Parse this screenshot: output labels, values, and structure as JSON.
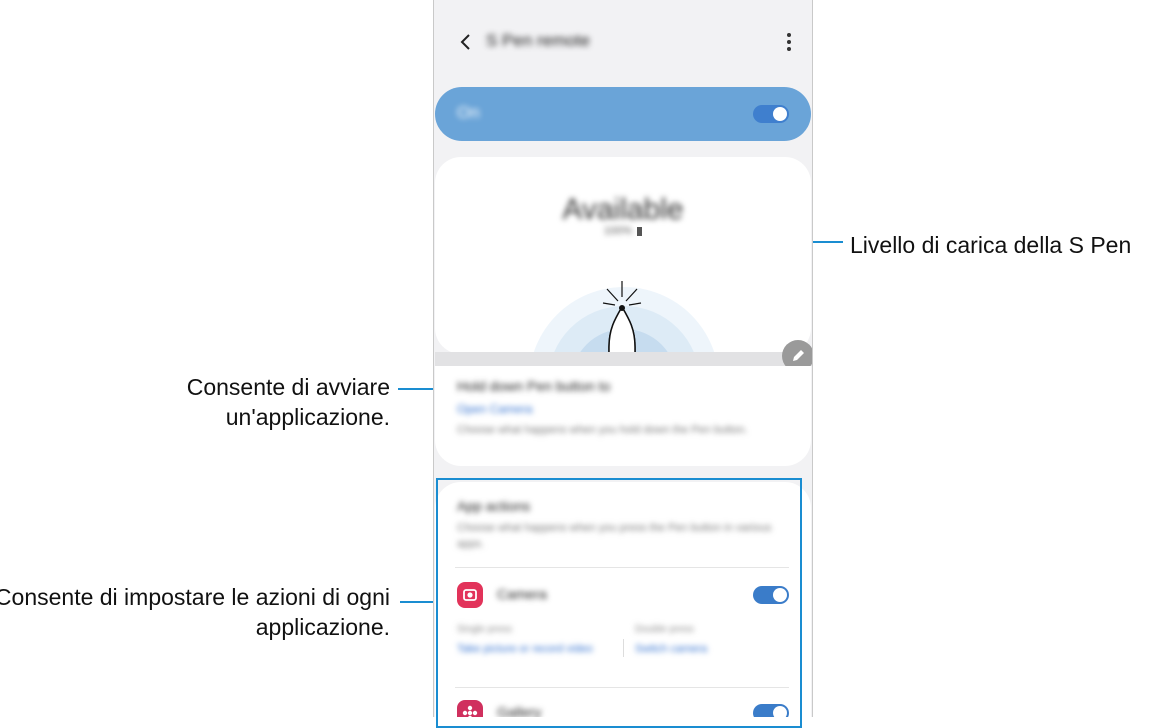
{
  "callouts": {
    "battery_level": "Livello di carica della S Pen",
    "launch_app": "Consente di avviare un'applicazione.",
    "app_actions": "Consente di impostare le azioni di ogni applicazione."
  },
  "appbar": {
    "title": "S Pen remote"
  },
  "master_switch": {
    "label": "On",
    "on": true
  },
  "status": {
    "title": "Available",
    "battery": "100%"
  },
  "hold_down": {
    "title": "Hold down Pen button to",
    "value": "Open Camera",
    "description": "Choose what happens when you hold down the Pen button."
  },
  "app_actions": {
    "title": "App actions",
    "description": "Choose what happens when you press the Pen button in various apps.",
    "apps": [
      {
        "name": "Camera",
        "icon": "camera-icon",
        "color": "#e2335a",
        "on": true,
        "single_label": "Single press",
        "single_value": "Take picture or record video",
        "double_label": "Double press",
        "double_value": "Switch camera"
      },
      {
        "name": "Gallery",
        "icon": "gallery-icon",
        "color": "#d0305e",
        "on": true
      }
    ]
  },
  "colors": {
    "accent": "#1a8dd1",
    "toggle": "#3a7cc9",
    "switch_bar": "#6aa4d8"
  }
}
